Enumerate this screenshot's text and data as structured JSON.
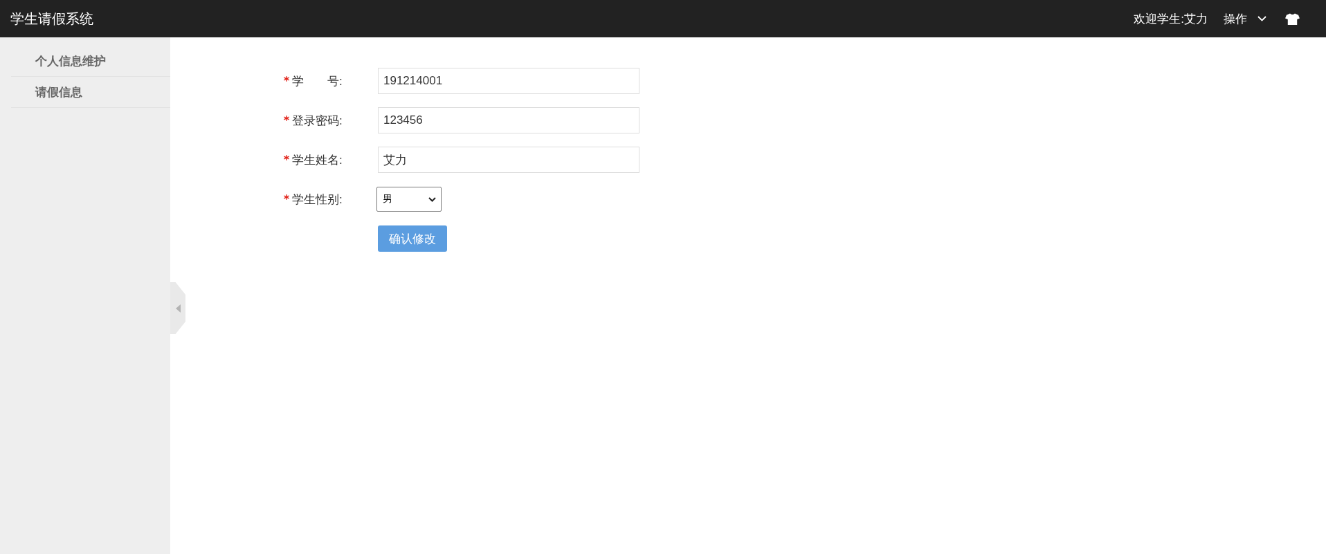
{
  "header": {
    "title": "学生请假系统",
    "welcome": "欢迎学生:艾力",
    "menu": {
      "label": "操作"
    }
  },
  "sidebar": {
    "items": [
      {
        "label": "个人信息维护",
        "selected": false
      },
      {
        "label": "请假信息",
        "selected": false
      }
    ]
  },
  "form": {
    "fields": [
      {
        "kind": "text",
        "label": "学　　号:",
        "required": true,
        "value": "191214001"
      },
      {
        "kind": "text",
        "label": "登录密码:",
        "required": true,
        "value": "123456"
      },
      {
        "kind": "text",
        "label": "学生姓名:",
        "required": true,
        "value": "艾力"
      },
      {
        "kind": "select",
        "label": "学生性别:",
        "required": true,
        "value": "男"
      }
    ],
    "submit": "确认修改"
  }
}
